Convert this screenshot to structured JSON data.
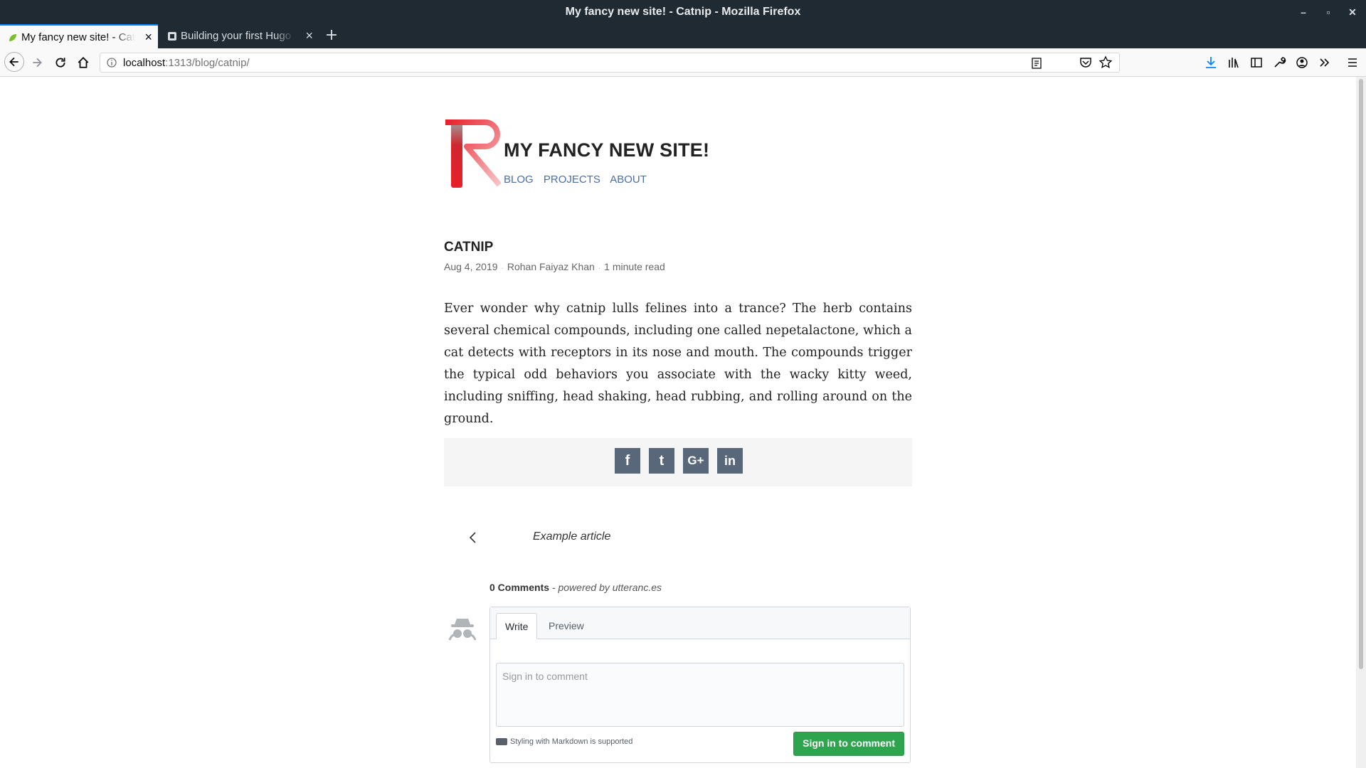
{
  "browser": {
    "window_title": "My fancy new site! - Catnip - Mozilla Firefox",
    "tabs": [
      {
        "label": "My fancy new site! - Catnip",
        "active": true
      },
      {
        "label": "Building your first Hugo site",
        "active": false
      }
    ],
    "url": {
      "host": "localhost",
      "path": ":1313/blog/catnip/"
    },
    "icons": {
      "back": "back-arrow-icon",
      "forward": "forward-arrow-icon",
      "reload": "reload-icon",
      "home": "home-icon",
      "info": "info-icon",
      "reader": "reader-view-icon",
      "more": "more-dots-icon",
      "pocket": "pocket-icon",
      "bookmark": "star-icon",
      "download": "download-icon",
      "library": "library-icon",
      "sidebar": "sidebar-icon",
      "devtools": "wrench-icon",
      "account": "account-icon",
      "overflow": "overflow-icon",
      "menu": "hamburger-menu-icon"
    },
    "accent": "#0a84ff"
  },
  "site": {
    "title": "MY FANCY NEW SITE!",
    "nav": [
      "BLOG",
      "PROJECTS",
      "ABOUT"
    ],
    "logo_color": "#e8202a"
  },
  "post": {
    "title": "CATNIP",
    "date": "Aug 4, 2019",
    "author": "Rohan Faiyaz Khan",
    "read_time": "1 minute read",
    "body": "Ever wonder why catnip lulls felines into a trance? The herb contains several chemical compounds, including one called nepetalactone, which a cat detects with receptors in its nose and mouth. The compounds trigger the typical odd behaviors you associate with the wacky kitty weed, including sniffing, head shaking, head rubbing, and rolling around on the ground."
  },
  "share": {
    "buttons": [
      {
        "glyph": "f",
        "icon": "facebook-icon"
      },
      {
        "glyph": "t",
        "icon": "twitter-icon"
      },
      {
        "glyph": "G+",
        "icon": "google-plus-icon"
      },
      {
        "glyph": "in",
        "icon": "linkedin-icon"
      }
    ],
    "button_color": "#58677a"
  },
  "pagination": {
    "prev_label": "Example article"
  },
  "comments": {
    "count_label": "0 Comments",
    "powered_by": " - powered by utteranc.es",
    "tabs": [
      "Write",
      "Preview"
    ],
    "placeholder": "Sign in to comment",
    "markdown_note": "Styling with Markdown is supported",
    "submit_label": "Sign in to comment",
    "submit_color": "#2ea44f"
  }
}
